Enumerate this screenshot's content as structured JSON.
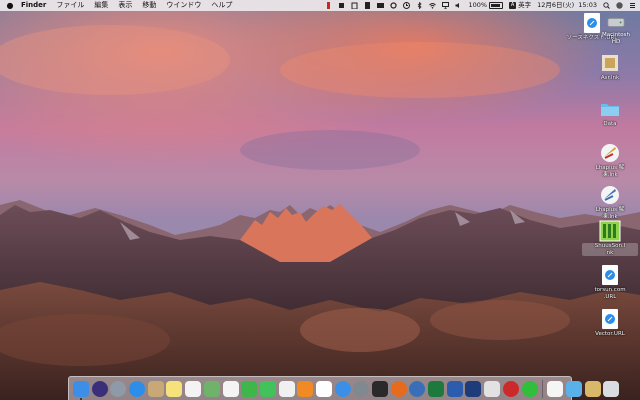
{
  "menubar": {
    "apple_icon": "apple-icon",
    "app_name": "Finder",
    "menus": [
      "ファイル",
      "編集",
      "表示",
      "移動",
      "ウインドウ",
      "ヘルプ"
    ],
    "battery_percent": "100%",
    "input_method": "英字",
    "date": "12月6日(火)",
    "time": "15:03"
  },
  "desktop_icons": [
    {
      "label": "ソースネクスト.URL",
      "icon": "safari-webloc-icon"
    },
    {
      "label": "Macintosh\nHD",
      "icon": "hard-drive-icon"
    },
    {
      "label": "Asr.lnk",
      "icon": "shortcut-icon"
    },
    {
      "label": "Data",
      "icon": "folder-icon"
    },
    {
      "label": "Lhaplus 解\n凍.lnk",
      "icon": "lhaplus-icon"
    },
    {
      "label": "Lhaplus 解\n凍.lnk",
      "icon": "lhaplus-icon"
    },
    {
      "label": "ShuusSon.l\nnk",
      "icon": "app-shortcut-icon"
    },
    {
      "label": "torsun.com\n.URL",
      "icon": "safari-webloc-icon"
    },
    {
      "label": "Vector.URL",
      "icon": "safari-webloc-icon"
    }
  ],
  "dock": {
    "apps": [
      {
        "name": "finder",
        "color": "#3d8ee6",
        "running": true
      },
      {
        "name": "siri",
        "color": "#3b2f7a"
      },
      {
        "name": "launchpad",
        "color": "#8e9aa8"
      },
      {
        "name": "safari",
        "color": "#2c8ee8"
      },
      {
        "name": "contacts",
        "color": "#c9a877"
      },
      {
        "name": "notes",
        "color": "#f6e27a"
      },
      {
        "name": "reminders",
        "color": "#f3f3f3"
      },
      {
        "name": "maps",
        "color": "#6fb36b"
      },
      {
        "name": "photos",
        "color": "#f4f4f4"
      },
      {
        "name": "facetime",
        "color": "#3fb64a"
      },
      {
        "name": "messages",
        "color": "#42c25a"
      },
      {
        "name": "itunes",
        "color": "#f0f0f0"
      },
      {
        "name": "ibooks",
        "color": "#f08a24"
      },
      {
        "name": "calendar",
        "color": "#ffffff"
      },
      {
        "name": "app-store",
        "color": "#3b8fe6"
      },
      {
        "name": "system-preferences",
        "color": "#808890"
      },
      {
        "name": "terminal",
        "color": "#2a2a2a"
      },
      {
        "name": "firefox",
        "color": "#e66b1c"
      },
      {
        "name": "thunderbird",
        "color": "#3a6fb8"
      },
      {
        "name": "excel",
        "color": "#1e7a3c"
      },
      {
        "name": "word",
        "color": "#2b5cad"
      },
      {
        "name": "app-1",
        "color": "#1f3c7a"
      },
      {
        "name": "app-2",
        "color": "#e2e2e2"
      },
      {
        "name": "app-3",
        "color": "#cc2a2a"
      },
      {
        "name": "line",
        "color": "#2fbf3a"
      }
    ],
    "trailing": [
      {
        "name": "document-stack",
        "color": "#f5f5f5"
      },
      {
        "name": "downloads-folder",
        "color": "#5ab0e8"
      },
      {
        "name": "folder-stack",
        "color": "#d9b86a"
      },
      {
        "name": "trash",
        "color": "#d9dde2"
      }
    ]
  }
}
